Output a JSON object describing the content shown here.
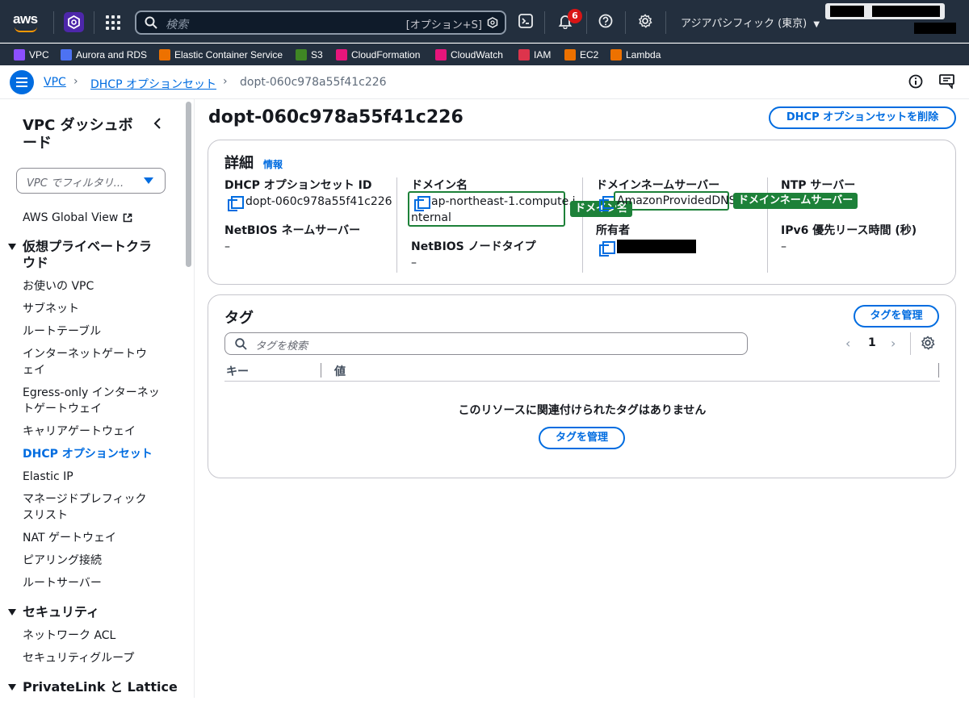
{
  "topnav": {
    "logo_text": "aws",
    "search_placeholder": "検索",
    "search_shortcut": "[オプション+S]",
    "notification_count": "6",
    "region": "アジアパシフィック (東京)"
  },
  "favorites": [
    {
      "label": "VPC",
      "color": "#8c4fff"
    },
    {
      "label": "Aurora and RDS",
      "color": "#4d72f3"
    },
    {
      "label": "Elastic Container Service",
      "color": "#ed7100"
    },
    {
      "label": "S3",
      "color": "#3f8624"
    },
    {
      "label": "CloudFormation",
      "color": "#e7157b"
    },
    {
      "label": "CloudWatch",
      "color": "#e7157b"
    },
    {
      "label": "IAM",
      "color": "#dd344c"
    },
    {
      "label": "EC2",
      "color": "#ed7100"
    },
    {
      "label": "Lambda",
      "color": "#ed7100"
    }
  ],
  "breadcrumb": {
    "vpc": "VPC",
    "dhcp": "DHCP オプションセット",
    "current": "dopt-060c978a55f41c226"
  },
  "sidebar": {
    "title": "VPC ダッシュボード",
    "filter_placeholder": "VPC でフィルタリ...",
    "global_view": "AWS Global View",
    "section_vpc": "仮想プライベートクラウド",
    "items": [
      "お使いの VPC",
      "サブネット",
      "ルートテーブル",
      "インターネットゲートウェイ",
      "Egress-only インターネットゲートウェイ",
      "キャリアゲートウェイ",
      "DHCP オプションセット",
      "Elastic IP",
      "マネージドプレフィックスリスト",
      "NAT ゲートウェイ",
      "ピアリング接続",
      "ルートサーバー"
    ],
    "section_security": "セキュリティ",
    "security_items": [
      "ネットワーク ACL",
      "セキュリティグループ"
    ],
    "section_privatelink": "PrivateLink と Lattice"
  },
  "main": {
    "title": "dopt-060c978a55f41c226",
    "delete_button": "DHCP オプションセットを削除",
    "details": {
      "heading": "詳細",
      "info": "情報",
      "id_label": "DHCP オプションセット ID",
      "id_value": "dopt-060c978a55f41c226",
      "netbios_ns_label": "NetBIOS ネームサーバー",
      "netbios_ns_value": "–",
      "domain_label": "ドメイン名",
      "domain_value_1": "ap-northeast-1.compute.i",
      "domain_value_2": "nternal",
      "netbios_type_label": "NetBIOS ノードタイプ",
      "netbios_type_value": "–",
      "dns_label": "ドメインネームサーバー",
      "dns_value": "AmazonProvidedDNS",
      "owner_label": "所有者",
      "ntp_label": "NTP サーバー",
      "ipv6_label": "IPv6 優先リース時間 (秒)",
      "ipv6_value": "–",
      "annot_domain": "ドメイン名",
      "annot_dns": "ドメインネームサーバー"
    },
    "tags": {
      "heading": "タグ",
      "manage_button": "タグを管理",
      "search_placeholder": "タグを検索",
      "page": "1",
      "col_key": "キー",
      "col_value": "値",
      "empty_text": "このリソースに関連付けられたタグはありません",
      "empty_button": "タグを管理"
    }
  }
}
